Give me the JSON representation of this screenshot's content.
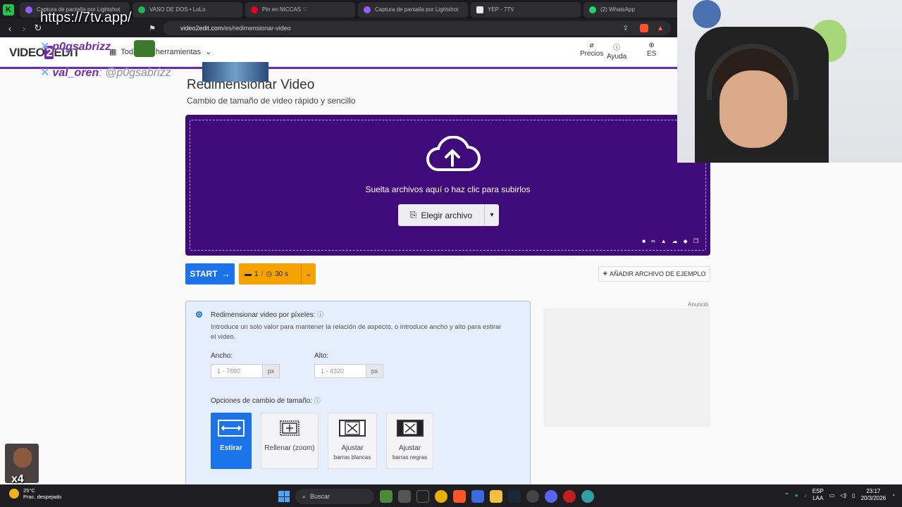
{
  "browser": {
    "tabs": [
      {
        "label": "Captura de pantalla por Lightshot",
        "color": "#9a5cff"
      },
      {
        "label": "VASO DE DOS • LoLo",
        "color": "#1db954"
      },
      {
        "label": "Pin en NICCAS ♡",
        "color": "#e60023"
      },
      {
        "label": "Captura de pantalla por Lightshot",
        "color": "#9a5cff"
      },
      {
        "label": "YEP - 7TV",
        "color": "#eeeeee"
      },
      {
        "label": "(2) WhatsApp",
        "color": "#25d366"
      }
    ],
    "address": {
      "domain": "video2edit.com",
      "path": "/es/redimensionar-video"
    }
  },
  "overlay": {
    "url_text": "https://7tv.app/",
    "user1": "p0gsabrizz",
    "user2_name": "val_oren",
    "user2_msg": ": @p0gsabrizz",
    "multiplier": "x4"
  },
  "site": {
    "logo_a": "VIDEO",
    "logo_b": "2",
    "logo_c": "EDIT",
    "tools_label": "Todas las herramientas",
    "nav": {
      "pricing": "Precios",
      "help": "Ayuda",
      "lang": "ES"
    }
  },
  "main": {
    "title": "Redimensionar Video",
    "subtitle": "Cambio de tamaño de video rápido y sencillo",
    "drop_text": "Suelta archivos aquí o haz clic para subirlos",
    "choose_label": "Elegir archivo",
    "start_label": "START",
    "limit_files": "1",
    "limit_time": "30 s",
    "sample_label": "AÑADIR ARCHIVO DE EJEMPLO"
  },
  "options": {
    "title": "Redimensionar video por píxeles:",
    "desc": "Introduce un solo valor para mantener la relación de aspecto, o introduce ancho y alto para estirar el video.",
    "width_label": "Ancho:",
    "width_placeholder": "1 - 7680",
    "height_label": "Alto:",
    "height_placeholder": "1 - 4320",
    "unit": "px",
    "resize_label": "Opciones de cambio de tamaño:",
    "modes": [
      {
        "label": "Estirar",
        "sub": ""
      },
      {
        "label": "Rellenar (zoom)",
        "sub": ""
      },
      {
        "label": "Ajustar",
        "sub": "barras blancas"
      },
      {
        "label": "Ajustar",
        "sub": "barras negras"
      }
    ]
  },
  "ad": {
    "label": "Anuncio"
  },
  "taskbar": {
    "temp": "25°C",
    "weather": "Prac. despejado",
    "search": "Buscar",
    "lang": "ESP",
    "lang2": "LAA",
    "time": "23:17",
    "date": "20/3/2026"
  }
}
